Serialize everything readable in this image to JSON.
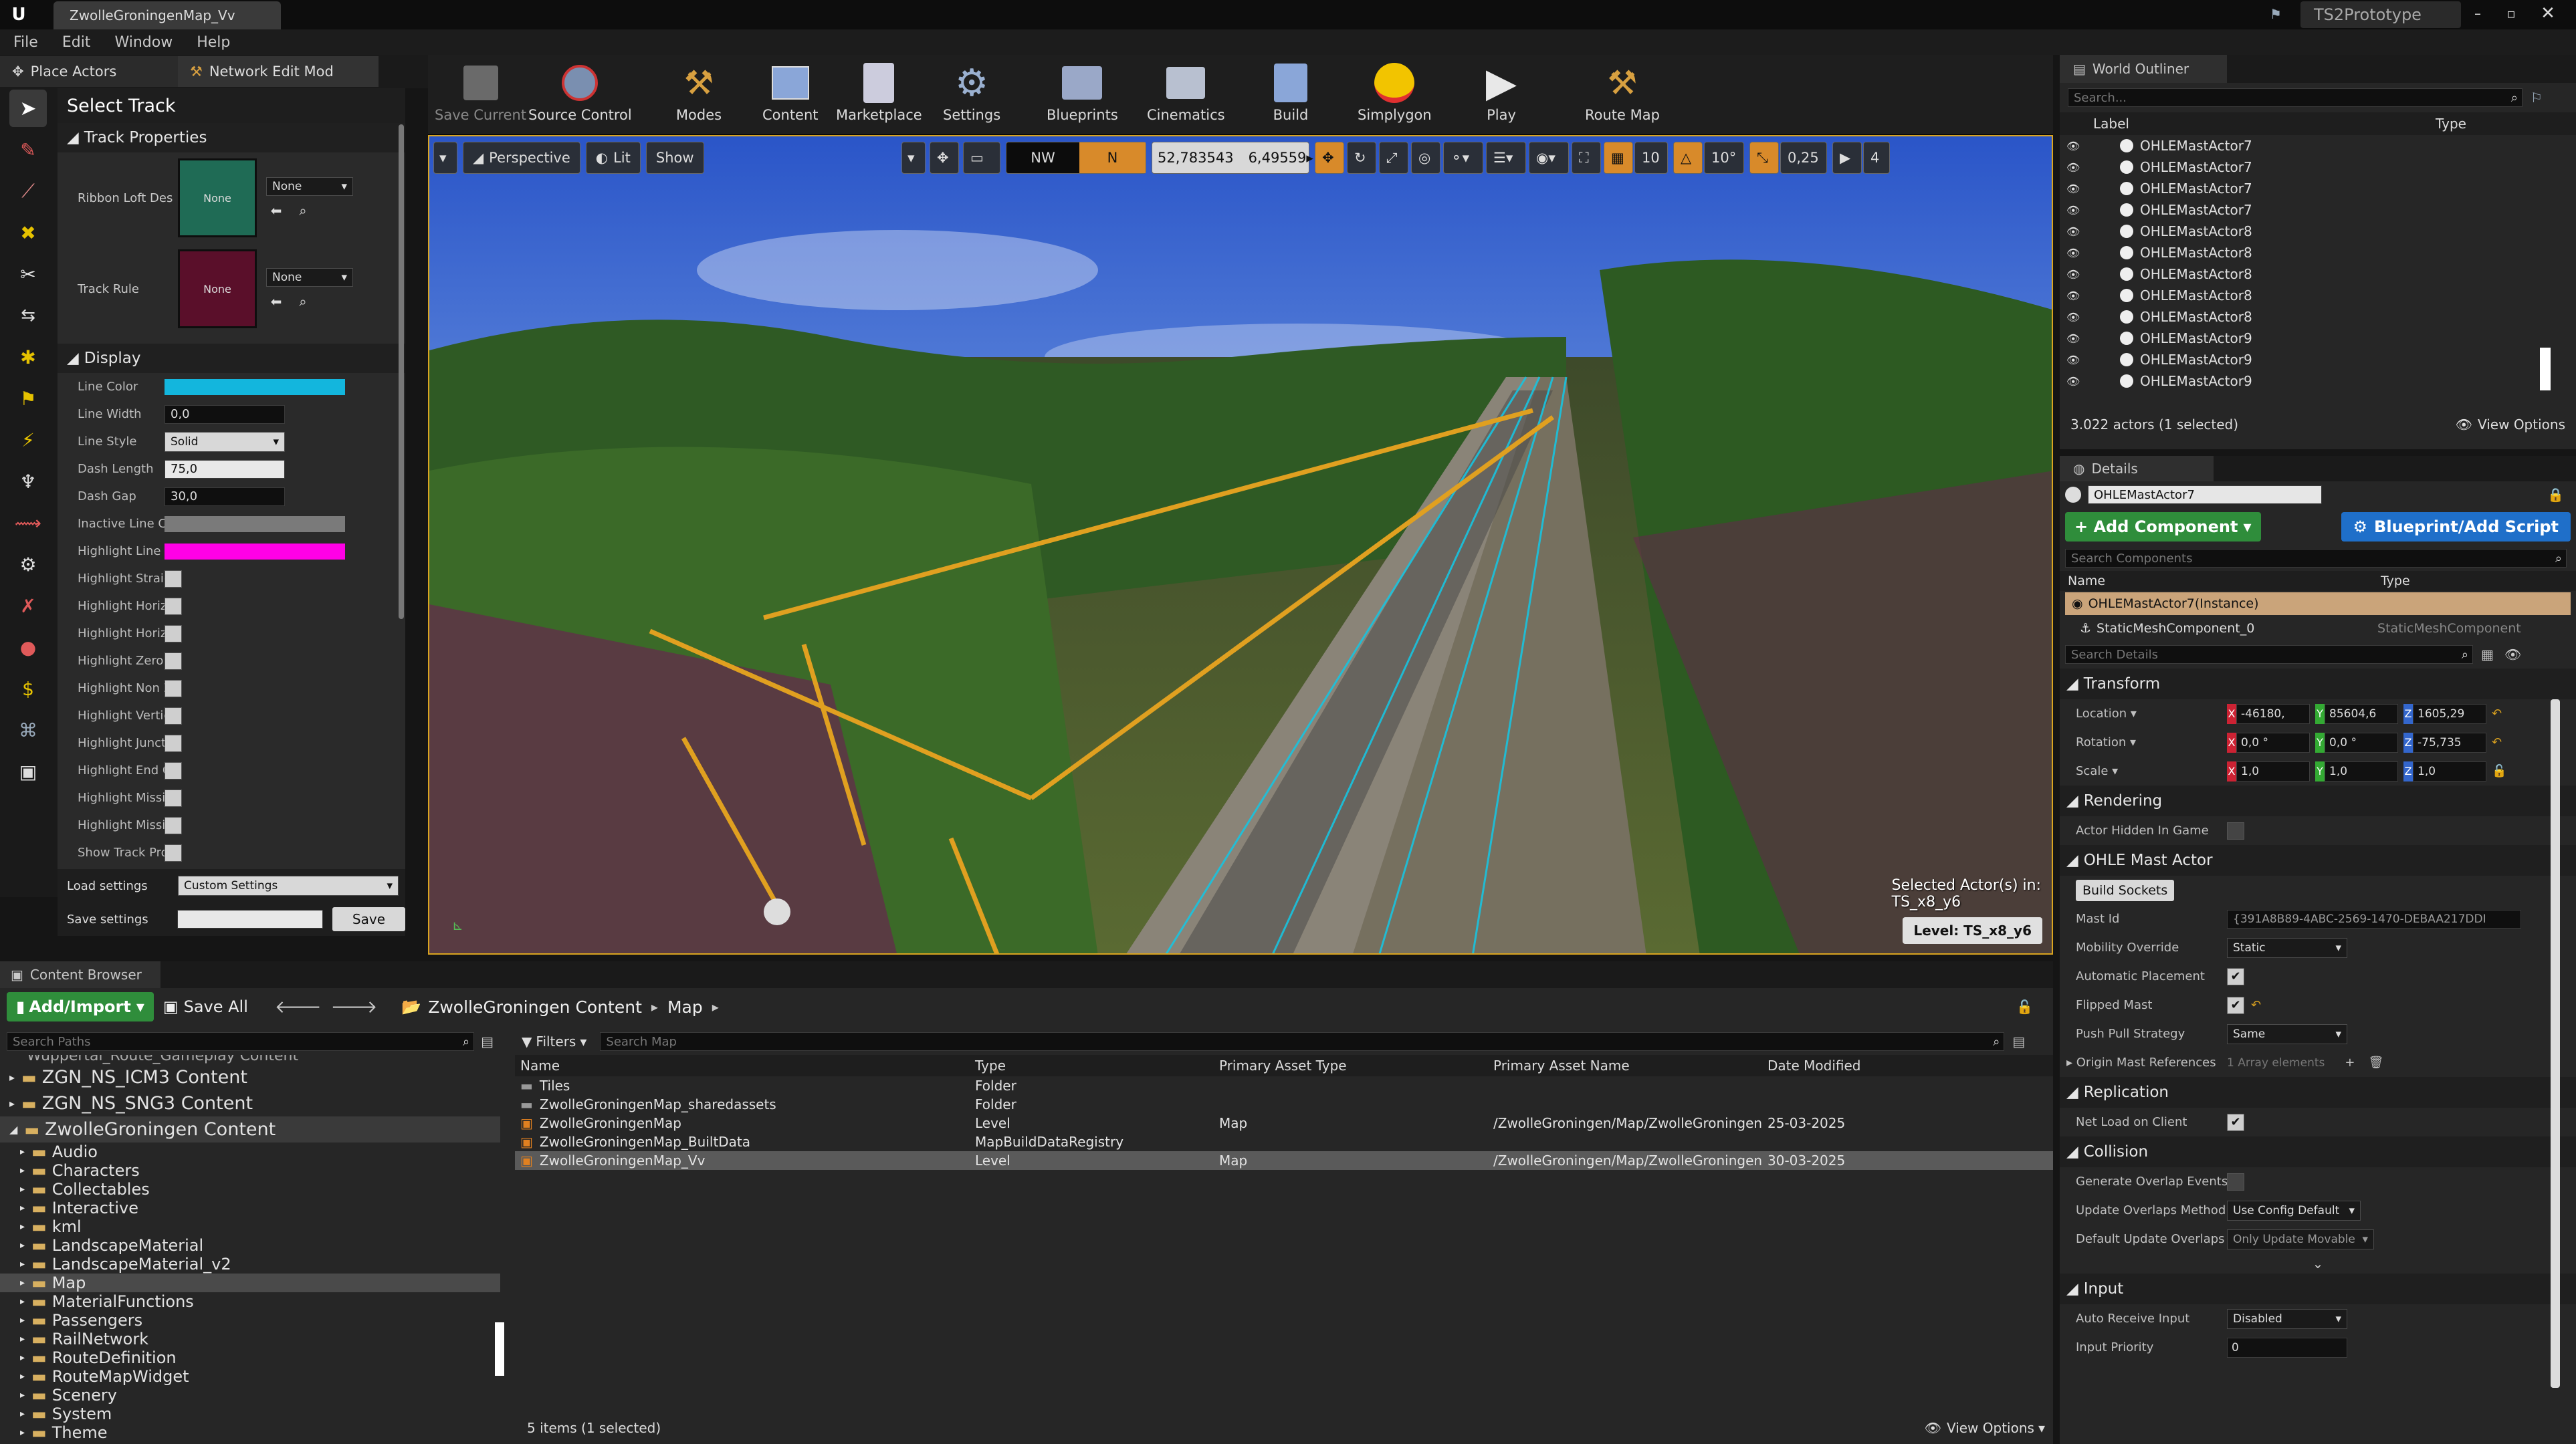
{
  "window": {
    "title_tab": "ZwolleGroningenMap_Vv",
    "project_name": "TS2Prototype",
    "accent_color": "#d9a420"
  },
  "menu": [
    "File",
    "Edit",
    "Window",
    "Help"
  ],
  "modes_tabs": {
    "place_actors": "Place Actors",
    "network_edit": "Network Edit Mod"
  },
  "select_panel": {
    "title": "Select Track",
    "track_properties_header": "Track Properties",
    "ribbon_label": "Ribbon Loft Des",
    "ribbon_value": "None",
    "ribbon_dropdown": "None",
    "track_rule_label": "Track Rule",
    "track_rule_value": "None",
    "track_rule_dropdown": "None",
    "display_header": "Display",
    "line_color_label": "Line Color",
    "line_width_label": "Line Width",
    "line_width_value": "0,0",
    "line_style_label": "Line Style",
    "line_style_value": "Solid",
    "dash_length_label": "Dash Length",
    "dash_length_value": "75,0",
    "dash_gap_label": "Dash Gap",
    "dash_gap_value": "30,0",
    "inactive_label": "Inactive Line Co",
    "highlight_color_label": "Highlight Line C",
    "checks": [
      "Highlight Straigl",
      "Highlight Horizo",
      "Highlight Horizo",
      "Highlight Zero G",
      "Highlight Non Z(",
      "Highlight Vertic",
      "Highlight Juncti",
      "Highlight End Of",
      "Highlight Missin",
      "Highlight Missin",
      "Show Track Pro("
    ],
    "load_settings_label": "Load settings",
    "load_settings_value": "Custom Settings",
    "save_settings_label": "Save settings",
    "save_button": "Save",
    "colors": {
      "line": "#13b6dd",
      "inactive": "#7a7a7a",
      "highlight": "#ff00e6"
    }
  },
  "toolbar": {
    "save_current": "Save Current",
    "source_control": "Source Control",
    "modes": "Modes",
    "content": "Content",
    "marketplace": "Marketplace",
    "settings": "Settings",
    "blueprints": "Blueprints",
    "cinematics": "Cinematics",
    "build": "Build",
    "simplygon": "Simplygon",
    "play": "Play",
    "route_map": "Route Map"
  },
  "viewport": {
    "perspective": "Perspective",
    "lit": "Lit",
    "show": "Show",
    "compass_nw": "NW",
    "compass_n": "N",
    "coord_lat": "52,783543",
    "coord_lon": "6,49559",
    "grid_snap": "10",
    "rot_snap": "10°",
    "scale_snap": "0,25",
    "camera_speed": "4",
    "selected_actors_label": "Selected Actor(s) in:",
    "selected_actors_value": "TS_x8_y6",
    "level_label": "Level:  TS_x8_y6"
  },
  "outliner": {
    "tab": "World Outliner",
    "search_placeholder": "Search...",
    "col_label": "Label",
    "col_type": "Type",
    "items": [
      "OHLEMastActor7",
      "OHLEMastActor7",
      "OHLEMastActor7",
      "OHLEMastActor7",
      "OHLEMastActor8",
      "OHLEMastActor8",
      "OHLEMastActor8",
      "OHLEMastActor8",
      "OHLEMastActor8",
      "OHLEMastActor9",
      "OHLEMastActor9",
      "OHLEMastActor9"
    ],
    "status": "3.022 actors (1 selected)",
    "view_options": "View Options"
  },
  "details": {
    "tab": "Details",
    "actor_name": "OHLEMastActor7",
    "add_component": "+ Add Component",
    "blueprint_script": "Blueprint/Add Script",
    "search_components": "Search Components",
    "col_name": "Name",
    "col_type": "Type",
    "instance": "OHLEMastActor7(Instance)",
    "component": "StaticMeshComponent_0",
    "component_type": "StaticMeshComponent",
    "search_details": "Search Details",
    "transform": "Transform",
    "location": "Location",
    "rotation": "Rotation",
    "scale": "Scale",
    "loc_x": "-46180,",
    "loc_y": "85604,6",
    "loc_z": "1605,29",
    "rot_x": "0,0 °",
    "rot_y": "0,0 °",
    "rot_z": "-75,735",
    "scl_x": "1,0",
    "scl_y": "1,0",
    "scl_z": "1,0",
    "rendering": "Rendering",
    "actor_hidden": "Actor Hidden In Game",
    "ohle_header": "OHLE Mast Actor",
    "build_sockets": "Build Sockets",
    "mast_id_label": "Mast Id",
    "mast_id_value": "{391A8B89-4ABC-2569-1470-DEBAA217DDI",
    "mobility_label": "Mobility Override",
    "mobility_value": "Static",
    "auto_place": "Automatic Placement",
    "flipped": "Flipped Mast",
    "push_pull_label": "Push Pull Strategy",
    "push_pull_value": "Same",
    "origin_mast": "Origin Mast References",
    "origin_mast_value": "1 Array elements",
    "replication": "Replication",
    "net_load": "Net Load on Client",
    "collision": "Collision",
    "gen_overlap": "Generate Overlap Events D",
    "update_overlap": "Update Overlaps Method D",
    "update_overlap_value": "Use Config Default",
    "default_update": "Default Update Overlaps M",
    "default_update_value": "Only Update Movable",
    "input": "Input",
    "auto_receive": "Auto Receive Input",
    "auto_receive_value": "Disabled",
    "input_priority": "Input Priority",
    "input_priority_value": "0"
  },
  "content_browser": {
    "tab": "Content Browser",
    "add_import": "Add/Import",
    "save_all": "Save All",
    "crumb_root": "ZwolleGroningen Content",
    "crumb_map": "Map",
    "search_paths": "Search Paths",
    "filters": "Filters",
    "search_map": "Search Map",
    "tree_top": "Wuppertal_Route_Gameplay Content",
    "tree": [
      "ZGN_NS_ICM3 Content",
      "ZGN_NS_SNG3 Content",
      "ZwolleGroningen Content"
    ],
    "folders": [
      "Audio",
      "Characters",
      "Collectables",
      "Interactive",
      "kml",
      "LandscapeMaterial",
      "LandscapeMaterial_v2",
      "Map",
      "MaterialFunctions",
      "Passengers",
      "RailNetwork",
      "RouteDefinition",
      "RouteMapWidget",
      "Scenery",
      "System",
      "Theme"
    ],
    "columns": [
      "Name",
      "Type",
      "Primary Asset Type",
      "Primary Asset Name",
      "Date Modified"
    ],
    "rows": [
      {
        "name": "Tiles",
        "type": "Folder",
        "pat": "",
        "pan": "",
        "date": ""
      },
      {
        "name": "ZwolleGroningenMap_sharedassets",
        "type": "Folder",
        "pat": "",
        "pan": "",
        "date": ""
      },
      {
        "name": "ZwolleGroningenMap",
        "type": "Level",
        "pat": "Map",
        "pan": "/ZwolleGroningen/Map/ZwolleGroningenI",
        "date": "25-03-2025"
      },
      {
        "name": "ZwolleGroningenMap_BuiltData",
        "type": "MapBuildDataRegistry",
        "pat": "",
        "pan": "",
        "date": ""
      },
      {
        "name": "ZwolleGroningenMap_Vv",
        "type": "Level",
        "pat": "Map",
        "pan": "/ZwolleGroningen/Map/ZwolleGroningenI",
        "date": "30-03-2025"
      }
    ],
    "status": "5 items (1 selected)",
    "view_options": "View Options"
  }
}
